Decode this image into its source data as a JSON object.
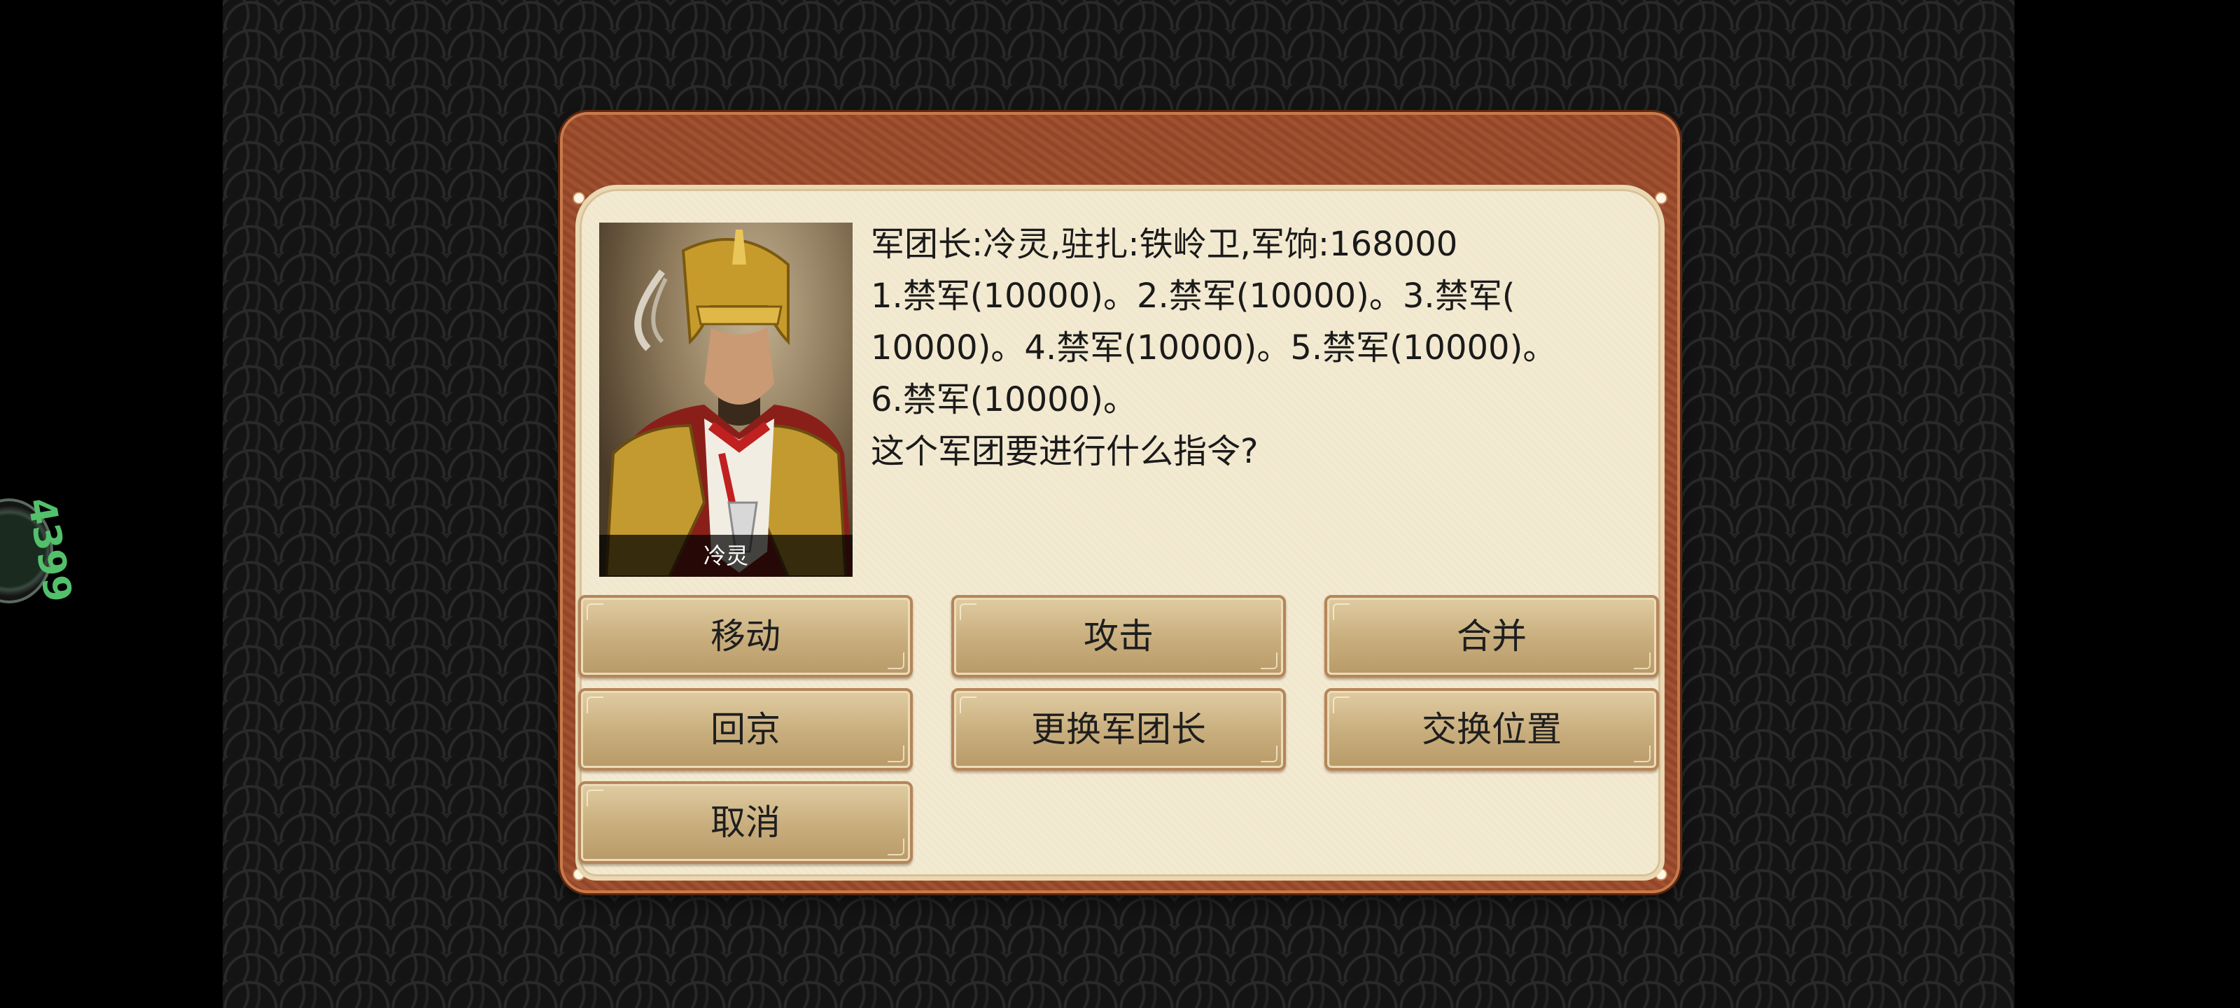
{
  "dialog": {
    "portrait_name": "冷灵",
    "info_lines": [
      "军团长:冷灵,驻扎:铁岭卫,军饷:168000",
      "1.禁军(10000)。2.禁军(10000)。3.禁军(",
      "10000)。4.禁军(10000)。5.禁军(10000)。",
      "6.禁军(10000)。",
      "这个军团要进行什么指令?"
    ],
    "buttons": {
      "move": "移动",
      "attack": "攻击",
      "merge": "合并",
      "return_capital": "回京",
      "change_commander": "更换军团长",
      "swap_position": "交换位置",
      "cancel": "取消"
    }
  },
  "colors": {
    "frame": "#9b4a2a",
    "panel": "#f3ead2",
    "button": "#c8ad7c"
  }
}
